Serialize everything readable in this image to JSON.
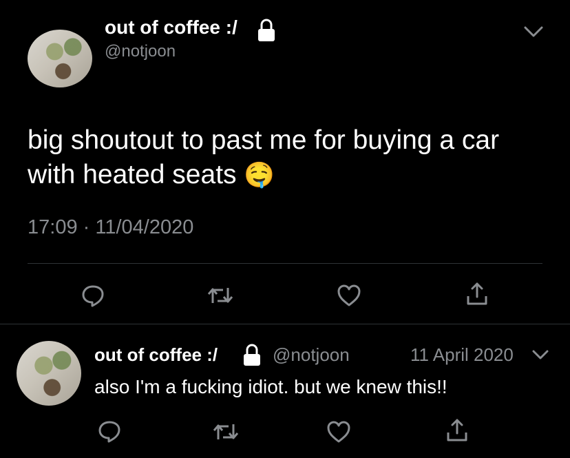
{
  "main_tweet": {
    "display_name": "out of coffee :/",
    "handle": "@notjoon",
    "text_line1": "big shoutout to past me for buying a car",
    "text_line2": "with heated seats",
    "emoji": "🤤",
    "time": "17:09",
    "separator": "·",
    "date": "11/04/2020"
  },
  "reply_tweet": {
    "display_name": "out of coffee :/",
    "handle": "@notjoon",
    "date": "11 April 2020",
    "text": "also I'm a fucking idiot. but we knew this!!"
  },
  "icons": {
    "lock": "lock-icon",
    "chevron": "chevron-down-icon",
    "reply": "reply-icon",
    "retweet": "retweet-icon",
    "like": "like-icon",
    "share": "share-icon"
  },
  "colors": {
    "background": "#000000",
    "text": "#ffffff",
    "muted": "#8a8d91",
    "divider": "#2f3336"
  }
}
